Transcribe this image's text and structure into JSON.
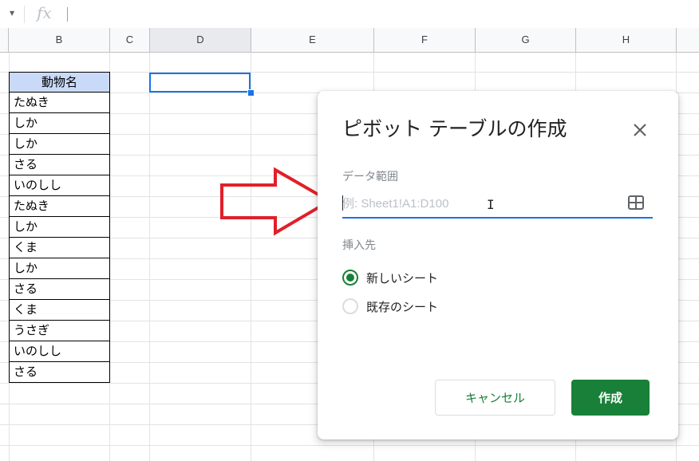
{
  "formula_bar": {
    "fx_label": "fx"
  },
  "columns": [
    "B",
    "C",
    "D",
    "E",
    "F",
    "G",
    "H"
  ],
  "sheet": {
    "header": "動物名",
    "rows": [
      "たぬき",
      "しか",
      "しか",
      "さる",
      "いのしし",
      "たぬき",
      "しか",
      "くま",
      "しか",
      "さる",
      "くま",
      "うさぎ",
      "いのしし",
      "さる"
    ]
  },
  "dialog": {
    "title": "ピボット テーブルの作成",
    "range_label": "データ範囲",
    "range_placeholder": "例: Sheet1!A1:D100",
    "range_value": "",
    "insert_label": "挿入先",
    "options": [
      "新しいシート",
      "既存のシート"
    ],
    "selected_option": "新しいシート",
    "cancel_label": "キャンセル",
    "create_label": "作成"
  },
  "colors": {
    "accent": "#1a73e8",
    "primary_green": "#188038",
    "header_fill": "#c9daf8",
    "arrow": "#e0202a"
  }
}
